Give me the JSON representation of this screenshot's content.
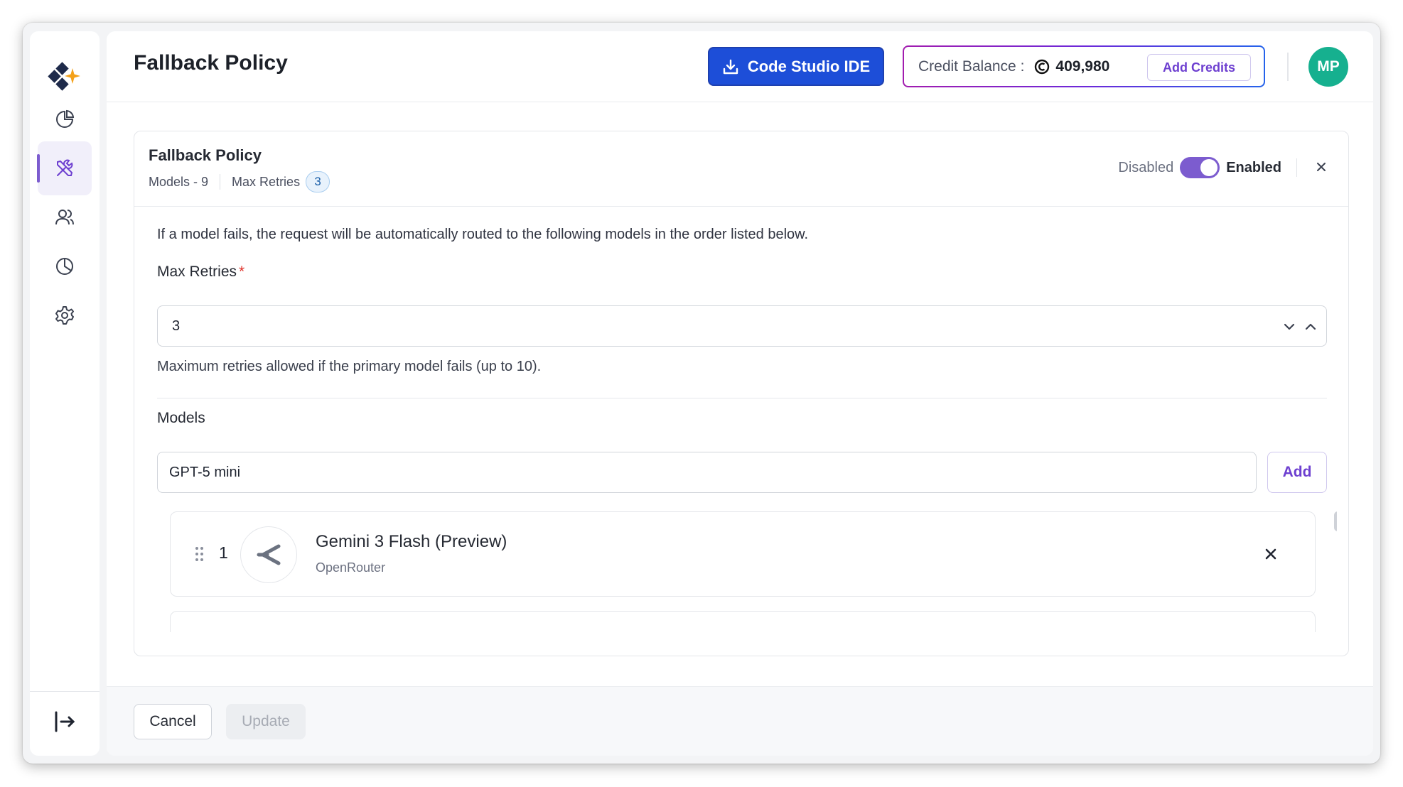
{
  "page": {
    "title": "Fallback Policy"
  },
  "header": {
    "studio_button": "Code Studio IDE",
    "credit_label": "Credit Balance :",
    "credit_value": "409,980",
    "add_credits": "Add Credits",
    "avatar_initials": "MP"
  },
  "sidebar": {
    "items": [
      {
        "name": "dashboard",
        "icon": "pie-chart-icon"
      },
      {
        "name": "tools",
        "icon": "tools-icon",
        "active": true
      },
      {
        "name": "users",
        "icon": "users-icon"
      },
      {
        "name": "usage",
        "icon": "chart-icon"
      },
      {
        "name": "settings",
        "icon": "gear-icon"
      }
    ],
    "logout_icon": "logout-icon"
  },
  "card": {
    "title": "Fallback Policy",
    "models_meta": "Models - 9",
    "retries_meta": "Max Retries",
    "retries_badge": "3",
    "toggle_off_label": "Disabled",
    "toggle_on_label": "Enabled",
    "toggle_state": true,
    "description": "If a model fails, the request will be automatically routed to the following models in the order listed below."
  },
  "form": {
    "max_retries_label": "Max Retries",
    "required_mark": "*",
    "max_retries_value": "3",
    "max_retries_hint": "Maximum retries allowed if the primary model fails (up to 10).",
    "models_label": "Models",
    "model_input_value": "GPT-5 mini",
    "add_button": "Add"
  },
  "models": [
    {
      "index": "1",
      "name": "Gemini 3 Flash (Preview)",
      "provider": "OpenRouter",
      "icon": "openrouter-icon"
    }
  ],
  "footer": {
    "cancel": "Cancel",
    "update": "Update"
  },
  "colors": {
    "accent": "#7c5ccf",
    "primary_button": "#1d4ed8",
    "avatar": "#16b08f"
  }
}
